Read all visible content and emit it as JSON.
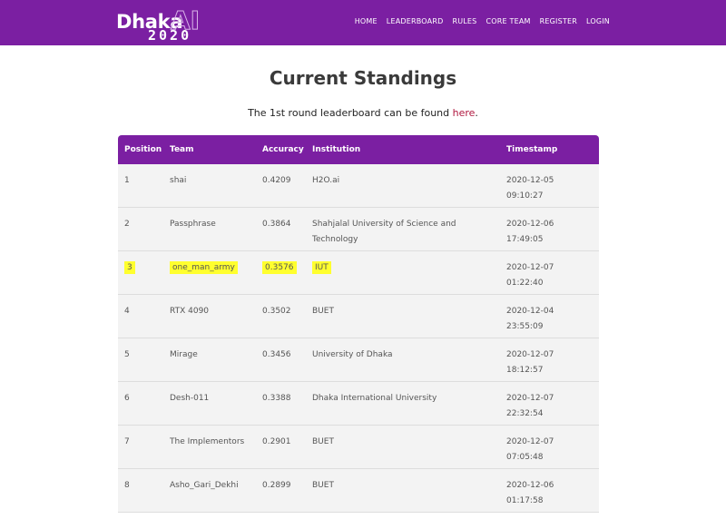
{
  "header": {
    "brand_word": "Dhaka",
    "brand_ai": "AI",
    "brand_year": "2020",
    "nav": [
      "HOME",
      "LEADERBOARD",
      "RULES",
      "CORE TEAM",
      "REGISTER",
      "LOGIN"
    ],
    "bg_color": "#7b1fa2"
  },
  "page": {
    "title": "Current Standings",
    "note_prefix": "The 1st round leaderboard can be found ",
    "note_link": "here",
    "note_suffix": "."
  },
  "table": {
    "columns": [
      "Position",
      "Team",
      "Accuracy",
      "Institution",
      "Timestamp"
    ],
    "rows": [
      {
        "position": "1",
        "team": "shai",
        "accuracy": "0.4209",
        "institution": "H2O.ai",
        "date": "2020-12-05",
        "time": "09:10:27"
      },
      {
        "position": "2",
        "team": "Passphrase",
        "accuracy": "0.3864",
        "institution": "Shahjalal University of Science and Technology",
        "date": "2020-12-06",
        "time": "17:49:05"
      },
      {
        "position": "3",
        "team": "one_man_army",
        "accuracy": "0.3576",
        "institution": "IUT",
        "date": "2020-12-07",
        "time": "01:22:40",
        "highlighted": true
      },
      {
        "position": "4",
        "team": "RTX 4090",
        "accuracy": "0.3502",
        "institution": "BUET",
        "date": "2020-12-04",
        "time": "23:55:09"
      },
      {
        "position": "5",
        "team": "Mirage",
        "accuracy": "0.3456",
        "institution": "University of Dhaka",
        "date": "2020-12-07",
        "time": "18:12:57"
      },
      {
        "position": "6",
        "team": "Desh-011",
        "accuracy": "0.3388",
        "institution": "Dhaka International University",
        "date": "2020-12-07",
        "time": "22:32:54"
      },
      {
        "position": "7",
        "team": "The Implementors",
        "accuracy": "0.2901",
        "institution": "BUET",
        "date": "2020-12-07",
        "time": "07:05:48"
      },
      {
        "position": "8",
        "team": "Asho_Gari_Dekhi",
        "accuracy": "0.2899",
        "institution": "BUET",
        "date": "2020-12-06",
        "time": "01:17:58"
      }
    ],
    "highlight_color": "#ffff2e"
  }
}
